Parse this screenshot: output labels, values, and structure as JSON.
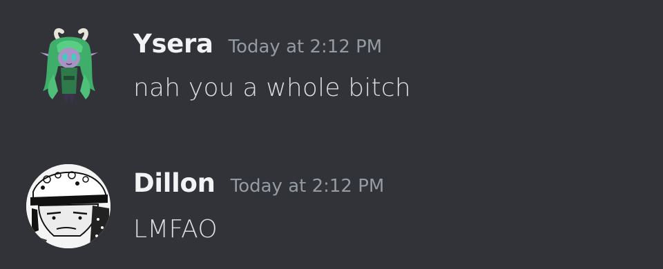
{
  "colors": {
    "background": "#313338",
    "username": "#f2f3f5",
    "timestamp": "#949ba4",
    "message_text": "#dbdee1"
  },
  "messages": [
    {
      "avatar": "avatar-image",
      "username": "Ysera",
      "timestamp": "Today at 2:12 PM",
      "content": "nah you a whole bitch"
    },
    {
      "avatar": "avatar-image",
      "username": "Dillon",
      "timestamp": "Today at 2:12 PM",
      "content": "LMFAO"
    }
  ]
}
